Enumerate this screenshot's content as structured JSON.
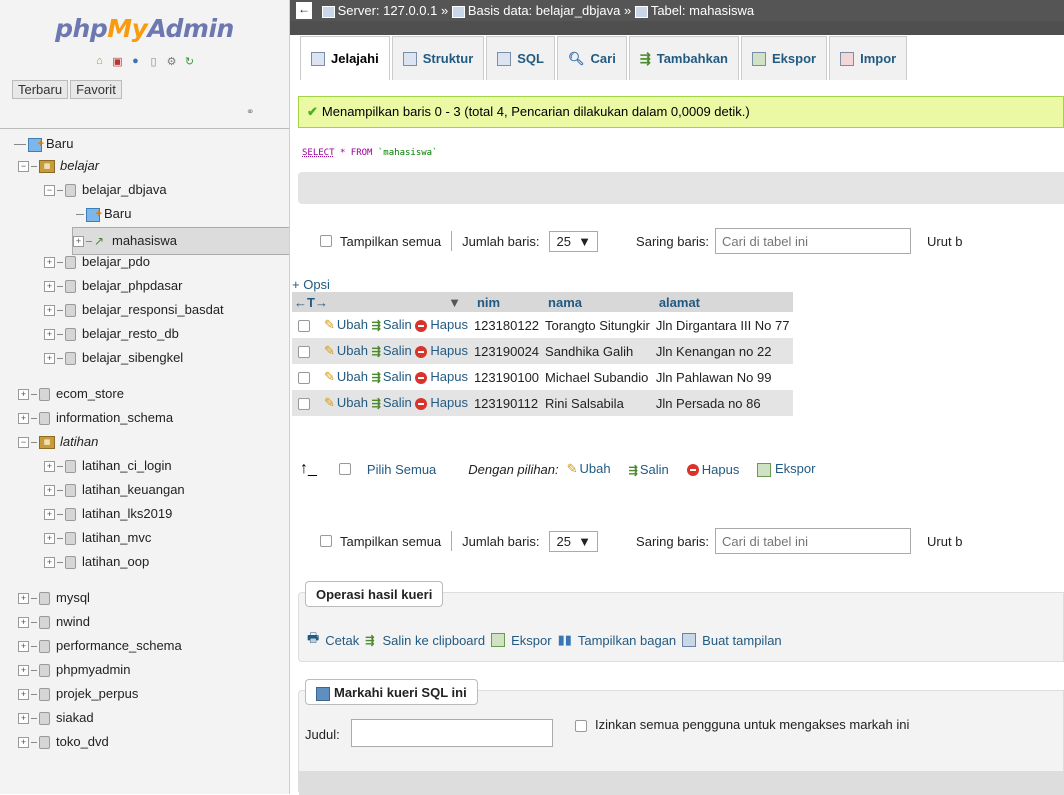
{
  "logo": {
    "part1": "php",
    "part2": "My",
    "part3": "Admin"
  },
  "sidebar": {
    "tabs": [
      "Terbaru",
      "Favorit"
    ],
    "new_label": "Baru",
    "tree": [
      {
        "label": "belajar",
        "kind": "group",
        "italic": true
      },
      {
        "label": "belajar_dbjava",
        "kind": "db",
        "indent": 1
      },
      {
        "label": "Baru",
        "kind": "new",
        "indent": 2
      },
      {
        "label": "mahasiswa",
        "kind": "table",
        "indent": 2,
        "selected": true
      },
      {
        "label": "belajar_pdo",
        "kind": "db",
        "indent": 1
      },
      {
        "label": "belajar_phpdasar",
        "kind": "db",
        "indent": 1
      },
      {
        "label": "belajar_responsi_basdat",
        "kind": "db",
        "indent": 1
      },
      {
        "label": "belajar_resto_db",
        "kind": "db",
        "indent": 1
      },
      {
        "label": "belajar_sibengkel",
        "kind": "db",
        "indent": 1
      },
      {
        "label": "ecom_store",
        "kind": "db",
        "indent": 0
      },
      {
        "label": "information_schema",
        "kind": "db",
        "indent": 0
      },
      {
        "label": "latihan",
        "kind": "group",
        "italic": true
      },
      {
        "label": "latihan_ci_login",
        "kind": "db",
        "indent": 1
      },
      {
        "label": "latihan_keuangan",
        "kind": "db",
        "indent": 1
      },
      {
        "label": "latihan_lks2019",
        "kind": "db",
        "indent": 1
      },
      {
        "label": "latihan_mvc",
        "kind": "db",
        "indent": 1
      },
      {
        "label": "latihan_oop",
        "kind": "db",
        "indent": 1
      },
      {
        "label": "mysql",
        "kind": "db",
        "indent": 0
      },
      {
        "label": "nwind",
        "kind": "db",
        "indent": 0
      },
      {
        "label": "performance_schema",
        "kind": "db",
        "indent": 0
      },
      {
        "label": "phpmyadmin",
        "kind": "db",
        "indent": 0
      },
      {
        "label": "projek_perpus",
        "kind": "db",
        "indent": 0
      },
      {
        "label": "siakad",
        "kind": "db",
        "indent": 0
      },
      {
        "label": "toko_dvd",
        "kind": "db",
        "indent": 0
      }
    ]
  },
  "breadcrumb": {
    "server": "Server: 127.0.0.1",
    "sep": "»",
    "database": "Basis data: belajar_dbjava",
    "table": "Tabel: mahasiswa"
  },
  "tabs": [
    "Jelajahi",
    "Struktur",
    "SQL",
    "Cari",
    "Tambahkan",
    "Ekspor",
    "Impor"
  ],
  "success_message": "Menampilkan baris 0 - 3 (total 4, Pencarian dilakukan dalam 0,0009 detik.)",
  "sql": {
    "select": "SELECT",
    "star": "*",
    "from": "FROM",
    "table": "`mahasiswa`"
  },
  "controls": {
    "show_all": "Tampilkan semua",
    "rows_label": "Jumlah baris:",
    "rows_value": "25",
    "filter_label": "Saring baris:",
    "filter_placeholder": "Cari di tabel ini",
    "sort_label": "Urut b"
  },
  "table": {
    "options_link": "+ Opsi",
    "arrows": "←T→",
    "columns": [
      "nim",
      "nama",
      "alamat"
    ],
    "actions": {
      "edit": "Ubah",
      "copy": "Salin",
      "delete": "Hapus"
    },
    "rows": [
      {
        "nim": "123180122",
        "nama": "Torangto Situngkir",
        "alamat": "Jln Dirgantara III No 77"
      },
      {
        "nim": "123190024",
        "nama": "Sandhika Galih",
        "alamat": "Jln Kenangan no 22"
      },
      {
        "nim": "123190100",
        "nama": "Michael Subandio",
        "alamat": "Jln Pahlawan No 99"
      },
      {
        "nim": "123190112",
        "nama": "Rini Salsabila",
        "alamat": "Jln Persada no 86"
      }
    ]
  },
  "bulk": {
    "select_all": "Pilih Semua",
    "with_selected": "Dengan pilihan:",
    "edit": "Ubah",
    "copy": "Salin",
    "delete": "Hapus",
    "export": "Ekspor"
  },
  "query_ops": {
    "title": "Operasi hasil kueri",
    "print": "Cetak",
    "copy_clipboard": "Salin ke clipboard",
    "export": "Ekspor",
    "chart": "Tampilkan bagan",
    "view": "Buat tampilan"
  },
  "bookmark": {
    "title": "Markahi kueri SQL ini",
    "label_title": "Judul:",
    "allow_all": "Izinkan semua pengguna untuk mengakses markah ini"
  },
  "colors": {
    "accent": "#235a81",
    "success_bg": "#ebf8a4",
    "success_border": "#a2d246"
  }
}
